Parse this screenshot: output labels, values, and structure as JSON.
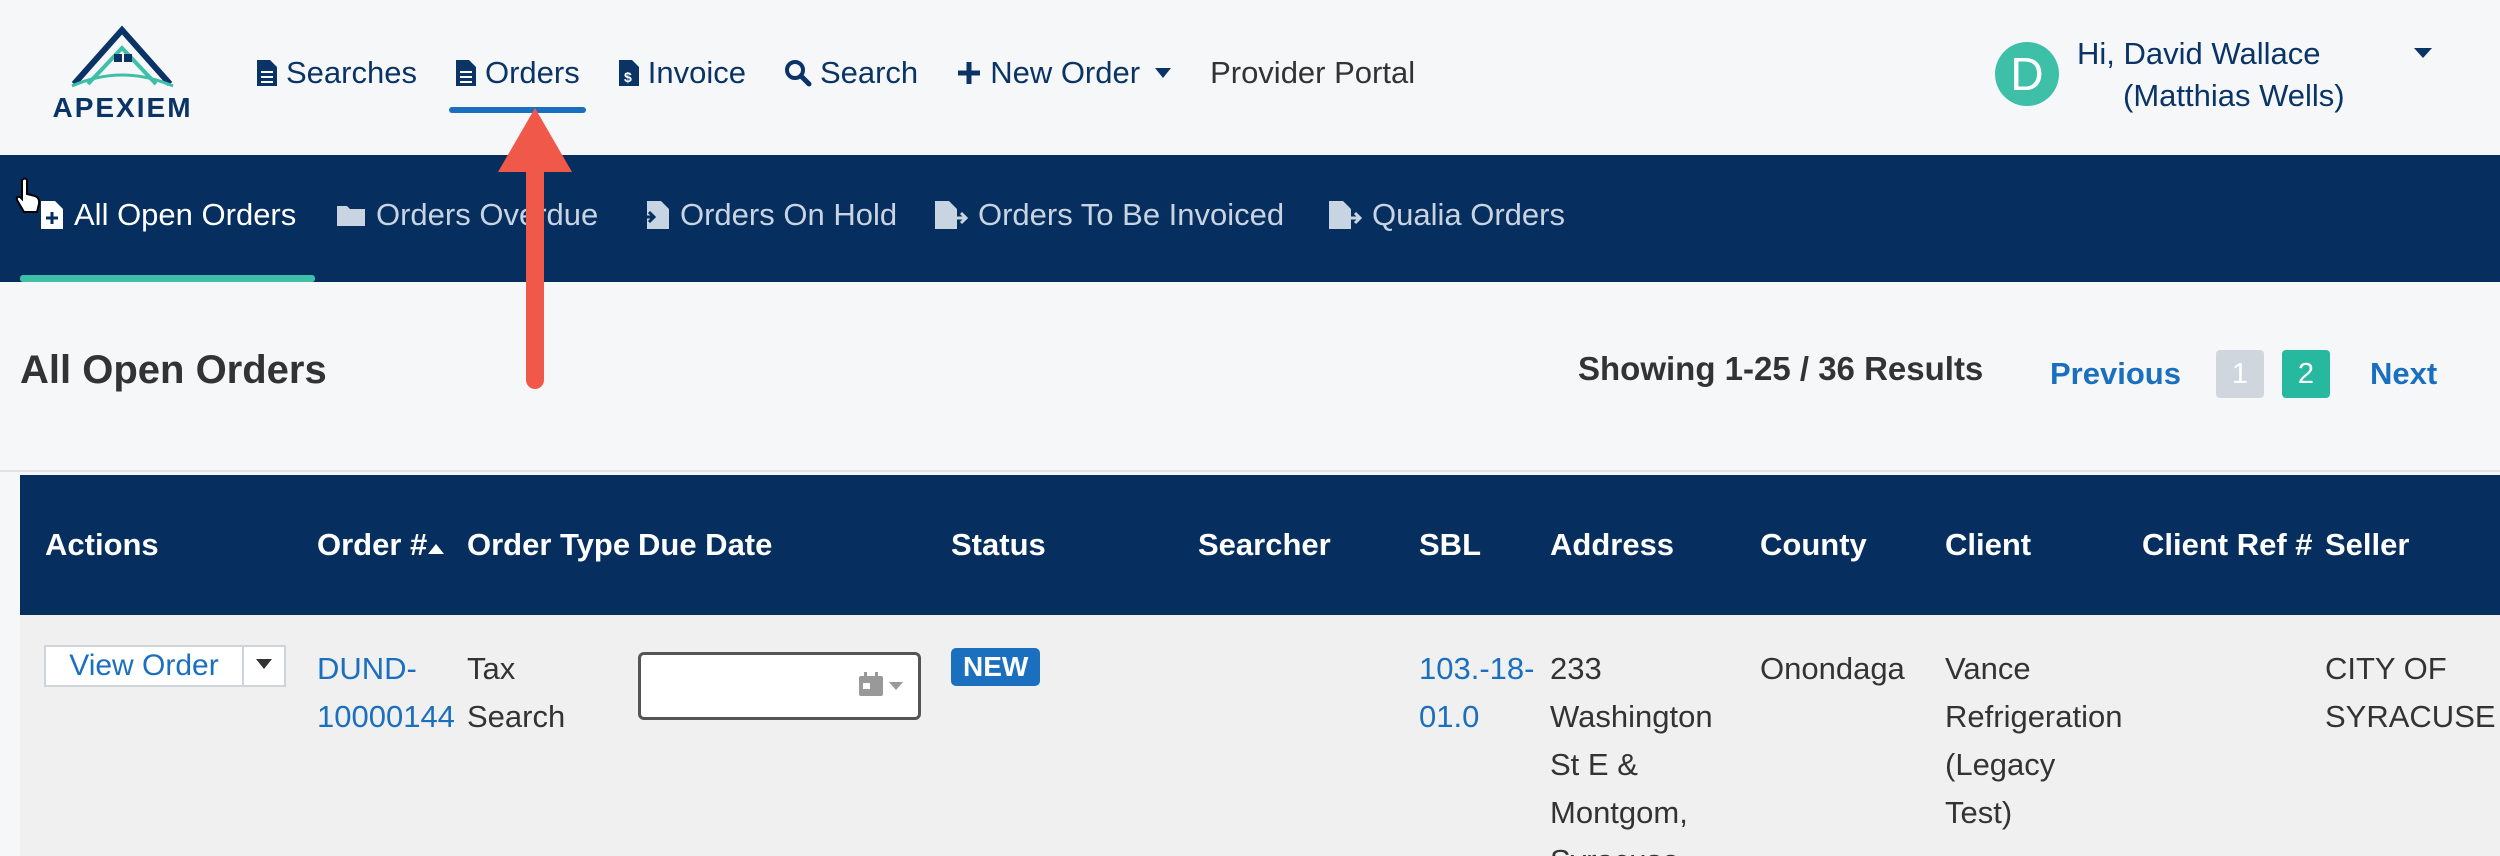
{
  "brand": {
    "name": "APEXIEM"
  },
  "nav": {
    "items": [
      {
        "label": "Searches",
        "icon": "file-text-icon"
      },
      {
        "label": "Orders",
        "icon": "file-text-icon",
        "active": true
      },
      {
        "label": "Invoice",
        "icon": "file-invoice-dollar-icon"
      },
      {
        "label": "Search",
        "icon": "search-icon"
      },
      {
        "label": "New Order",
        "icon": "plus-icon"
      },
      {
        "label": "Provider Portal"
      }
    ]
  },
  "user": {
    "initial": "D",
    "greeting": "Hi, David Wallace",
    "alias": "(Matthias Wells)"
  },
  "tabs": [
    {
      "label": "All Open Orders",
      "icon": "file-plus-icon",
      "active": true
    },
    {
      "label": "Orders Overdue",
      "icon": "folder-icon"
    },
    {
      "label": "Orders On Hold",
      "icon": "file-import-icon"
    },
    {
      "label": "Orders To Be Invoiced",
      "icon": "file-export-icon"
    },
    {
      "label": "Qualia Orders",
      "icon": "file-export-icon"
    }
  ],
  "page": {
    "title": "All Open Orders",
    "results": "Showing 1-25 / 36 Results",
    "pagination": {
      "previous": "Previous",
      "next": "Next",
      "pages": [
        "1",
        "2"
      ],
      "current": "2"
    }
  },
  "table": {
    "headers": [
      "Actions",
      "Order #",
      "Order Type",
      "Due Date",
      "Status",
      "Searcher",
      "SBL",
      "Address",
      "County",
      "Client",
      "Client Ref #",
      "Seller"
    ],
    "rows": [
      {
        "action": "View Order",
        "order_no": "DUND-10000144",
        "order_no_l1": "DUND-",
        "order_no_l2": "10000144",
        "order_type_l1": "Tax",
        "order_type_l2": "Search",
        "due_date": "",
        "status": "NEW",
        "searcher": "",
        "sbl_l1": "103.-18-",
        "sbl_l2": "01.0",
        "address_lines": [
          "233",
          "Washington",
          "St E &",
          "Montgom,",
          "Syracuse"
        ],
        "county": "Onondaga",
        "client_lines": [
          "Vance",
          "Refrigeration",
          "(Legacy",
          "Test)"
        ],
        "client_ref": "",
        "seller_l1": "CITY OF",
        "seller_l2": "SYRACUSE"
      }
    ]
  },
  "colors": {
    "navy": "#062f5f",
    "accent": "#3ebfa8",
    "link": "#1b6fbf",
    "annotation": "#f0584a"
  }
}
